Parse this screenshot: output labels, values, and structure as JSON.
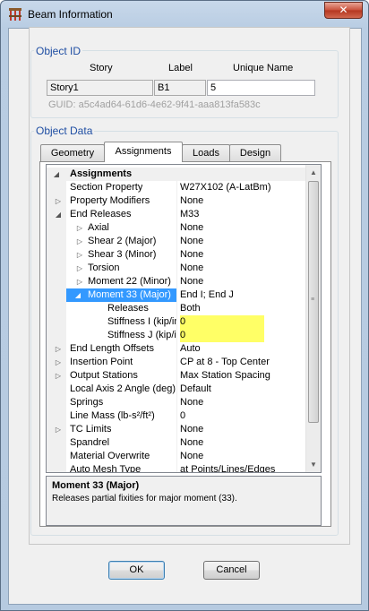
{
  "window": {
    "title": "Beam Information",
    "close_label": "✕"
  },
  "object_id": {
    "legend": "Object ID",
    "col_story": "Story",
    "col_label": "Label",
    "col_unique": "Unique Name",
    "story": "Story1",
    "label": "B1",
    "unique_name": "5",
    "guid": "GUID:  a5c4ad64-61d6-4e62-9f41-aaa813fa583c"
  },
  "object_data": {
    "legend": "Object Data",
    "tabs": [
      {
        "label": "Geometry"
      },
      {
        "label": "Assignments",
        "active": true
      },
      {
        "label": "Loads"
      },
      {
        "label": "Design"
      }
    ]
  },
  "grid": {
    "category": "Assignments",
    "rows": [
      {
        "name": "Section Property",
        "value": "W27X102 (A-LatBm)"
      },
      {
        "name": "Property Modifiers",
        "value": "None"
      },
      {
        "name": "End Releases",
        "value": "M33"
      },
      {
        "name": "Axial",
        "value": "None"
      },
      {
        "name": "Shear 2 (Major)",
        "value": "None"
      },
      {
        "name": "Shear 3 (Minor)",
        "value": "None"
      },
      {
        "name": "Torsion",
        "value": "None"
      },
      {
        "name": "Moment 22 (Minor)",
        "value": "None"
      },
      {
        "name": "Moment 33 (Major)",
        "value": "End I; End J"
      },
      {
        "name": "Releases",
        "value": "Both"
      },
      {
        "name": "Stiffness I (kip/in",
        "value": "0"
      },
      {
        "name": "Stiffness J (kip/in",
        "value": "0"
      },
      {
        "name": "End Length Offsets",
        "value": "Auto"
      },
      {
        "name": "Insertion Point",
        "value": "CP at 8 - Top Center"
      },
      {
        "name": "Output Stations",
        "value": "Max Station Spacing"
      },
      {
        "name": "Local Axis 2 Angle (deg)",
        "value": "Default"
      },
      {
        "name": "Springs",
        "value": "None"
      },
      {
        "name": "Line Mass (lb-s²/ft²)",
        "value": "0"
      },
      {
        "name": "TC Limits",
        "value": "None"
      },
      {
        "name": "Spandrel",
        "value": "None"
      },
      {
        "name": "Material Overwrite",
        "value": "None"
      },
      {
        "name": "Auto Mesh Type",
        "value": "at Points/Lines/Edges"
      }
    ]
  },
  "description": {
    "title": "Moment 33 (Major)",
    "text": "Releases  partial fixities for major moment (33)."
  },
  "buttons": {
    "ok": "OK",
    "cancel": "Cancel"
  },
  "icons": {
    "collapse": "◢",
    "expand": "▷",
    "scroll_up": "▲",
    "scroll_down": "▼"
  }
}
